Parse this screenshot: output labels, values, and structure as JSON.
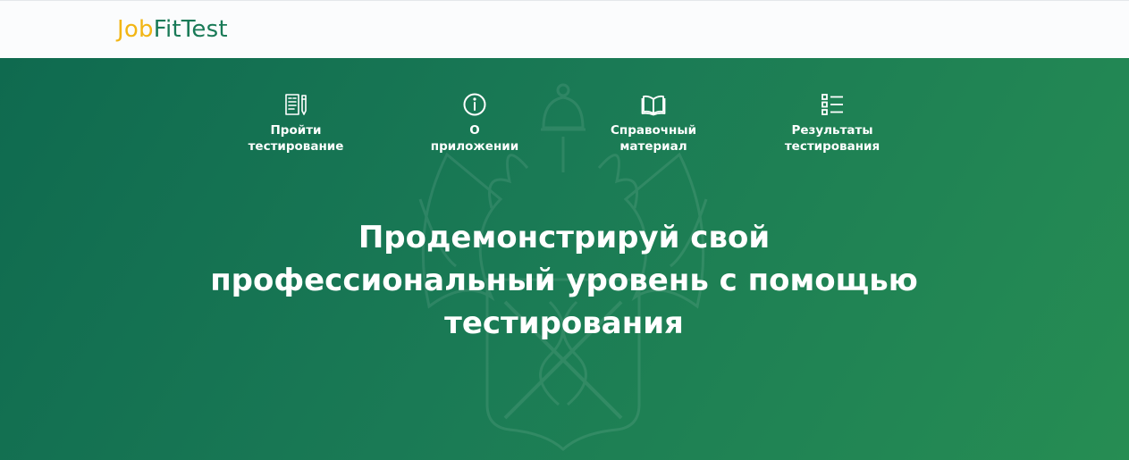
{
  "brand": {
    "part1": "Job",
    "part2": "FitTest",
    "color_primary": "#f2b615",
    "color_secondary": "#197a57"
  },
  "nav": {
    "items": [
      {
        "label": "Пройти\nтестирование",
        "icon": "test-document-pencil-icon"
      },
      {
        "label": "О\nприложении",
        "icon": "info-circle-icon"
      },
      {
        "label": "Справочный\nматериал",
        "icon": "open-book-icon"
      },
      {
        "label": "Результаты\nтестирования",
        "icon": "checklist-icon"
      }
    ]
  },
  "hero": {
    "headline": "Продемонстрируй свой\nпрофессиональный уровень с помощью\nтестирования",
    "background_icon": "double-headed-eagle-emblem-icon",
    "gradient_start": "#0f6a4f",
    "gradient_end": "#268d53"
  }
}
